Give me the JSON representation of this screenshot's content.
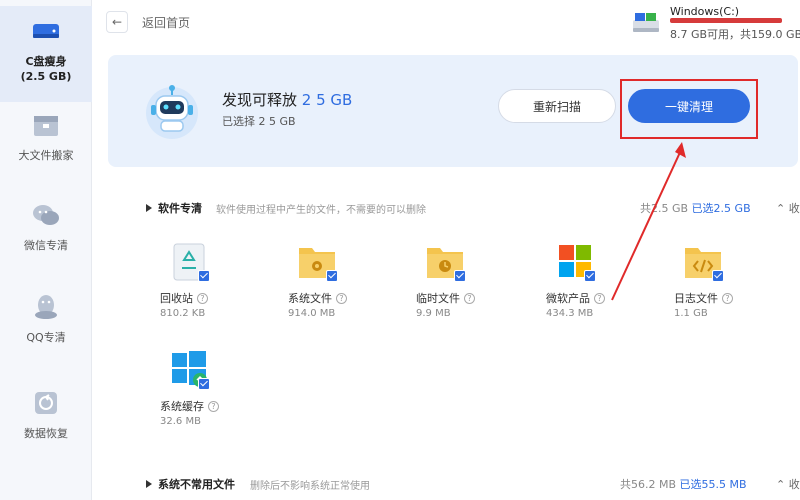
{
  "sidebar": {
    "items": [
      {
        "label": "C盘瘦身",
        "sub": "(2.5 GB)",
        "icon": "disk-icon",
        "active": true
      },
      {
        "label": "大文件搬家",
        "icon": "box-icon"
      },
      {
        "label": "微信专清",
        "icon": "wechat-icon"
      },
      {
        "label": "QQ专清",
        "icon": "qq-icon"
      },
      {
        "label": "数据恢复",
        "icon": "restore-icon"
      }
    ]
  },
  "topbar": {
    "back_icon": "←",
    "back_text": "返回首页"
  },
  "disk": {
    "name": "Windows(C:)",
    "info": "8.7 GB可用，共159.0 GB",
    "bar_color": "#d63b3b"
  },
  "banner": {
    "title_prefix": "发现可释放",
    "title_value": "2 5 GB",
    "subtitle": "已选择 2 5 GB",
    "rescan_label": "重新扫描",
    "clean_label": "一键清理"
  },
  "section_software": {
    "name": "软件专清",
    "desc": "软件使用过程中产生的文件，不需要的可以删除",
    "total_prefix": "共2.5 GB",
    "selected": "已选2.5 GB",
    "collapse_label": "收起",
    "items": [
      {
        "name": "回收站",
        "size": "810.2 KB",
        "icon": "recycle-bin-icon"
      },
      {
        "name": "系统文件",
        "size": "914.0 MB",
        "icon": "system-folder-icon"
      },
      {
        "name": "临时文件",
        "size": "9.9 MB",
        "icon": "temp-folder-icon"
      },
      {
        "name": "微软产品",
        "size": "434.3 MB",
        "icon": "microsoft-icon"
      },
      {
        "name": "日志文件",
        "size": "1.1 GB",
        "icon": "log-folder-icon"
      },
      {
        "name": "系统缓存",
        "size": "32.6 MB",
        "icon": "windows-cache-icon"
      }
    ]
  },
  "section_system": {
    "name": "系统不常用文件",
    "desc": "删除后不影响系统正常使用",
    "total_prefix": "共56.2 MB",
    "selected": "已选55.5 MB",
    "collapse_label": "收起"
  },
  "colors": {
    "accent": "#2f6de0",
    "highlight": "#e02a2a"
  }
}
